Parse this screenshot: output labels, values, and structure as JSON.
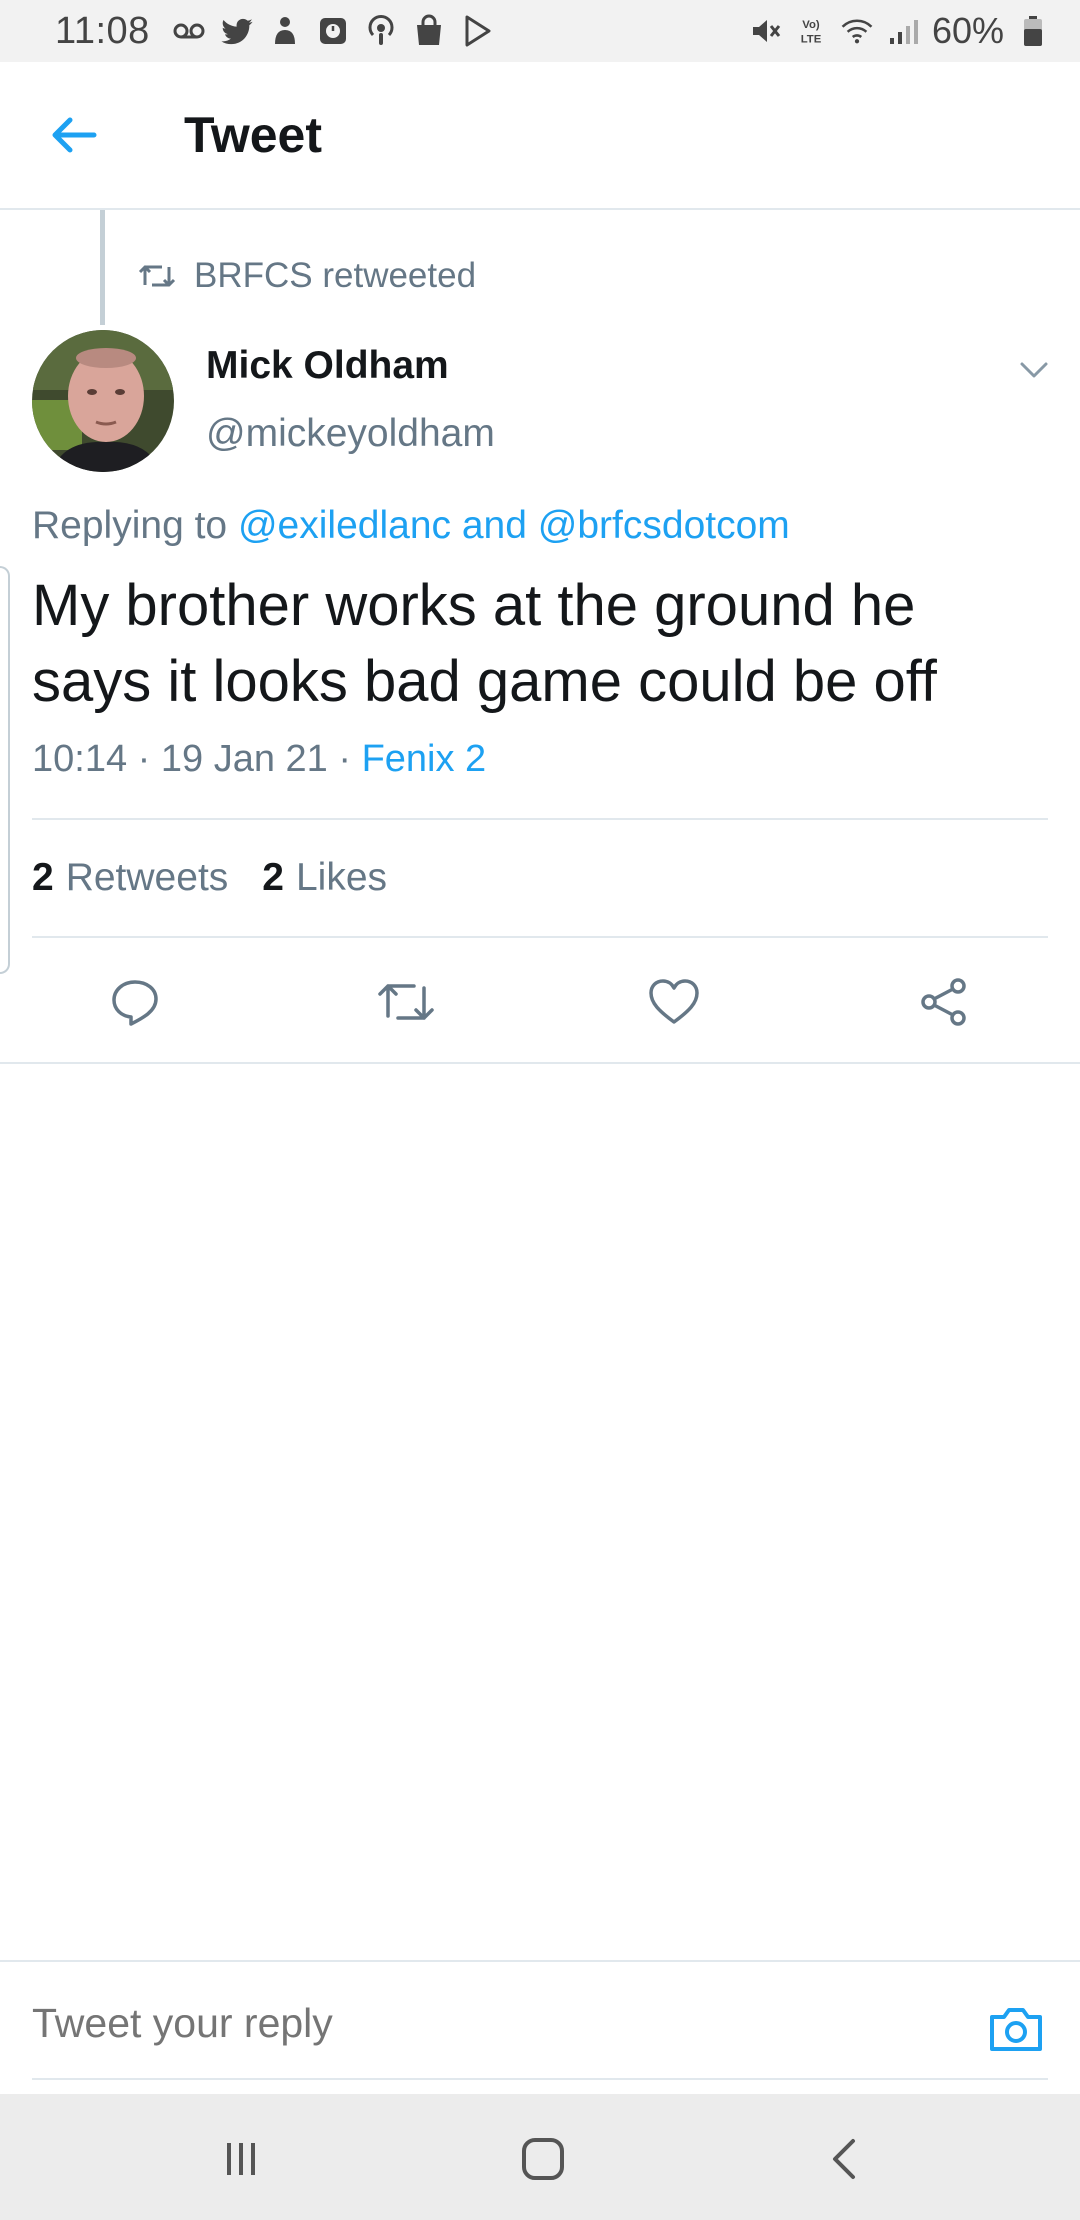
{
  "status_bar": {
    "time": "11:08",
    "battery_text": "60%",
    "left_icons": [
      "voicemail-icon",
      "twitter-icon",
      "game-icon",
      "clock-app-icon",
      "podcast-icon",
      "shopping-bag-icon",
      "play-store-icon"
    ],
    "right_icons": [
      "mute-icon",
      "volte-icon",
      "wifi-icon",
      "signal-icon",
      "battery-icon"
    ]
  },
  "app_bar": {
    "title": "Tweet",
    "accent_color": "#1da1f2"
  },
  "tweet": {
    "retweeted_by": "BRFCS retweeted",
    "author_name": "Mick Oldham",
    "author_handle": "@mickeyoldham",
    "replying_prefix": "Replying to",
    "reply_handle_1": "@exiledlanc",
    "reply_and": "and",
    "reply_handle_2": "@brfcsdotcom",
    "text": "My brother works at the ground he says it looks bad game could be off",
    "time": "10:14",
    "dot": "·",
    "date": "19 Jan 21",
    "source": "Fenix 2",
    "retweet_count": "2",
    "retweet_label": "Retweets",
    "like_count": "2",
    "like_label": "Likes"
  },
  "actions": [
    "reply-icon",
    "retweet-icon",
    "like-icon",
    "share-icon"
  ],
  "reply_bar": {
    "placeholder": "Tweet your reply"
  },
  "nav_bar": [
    "recent-apps-icon",
    "home-icon",
    "back-icon"
  ]
}
